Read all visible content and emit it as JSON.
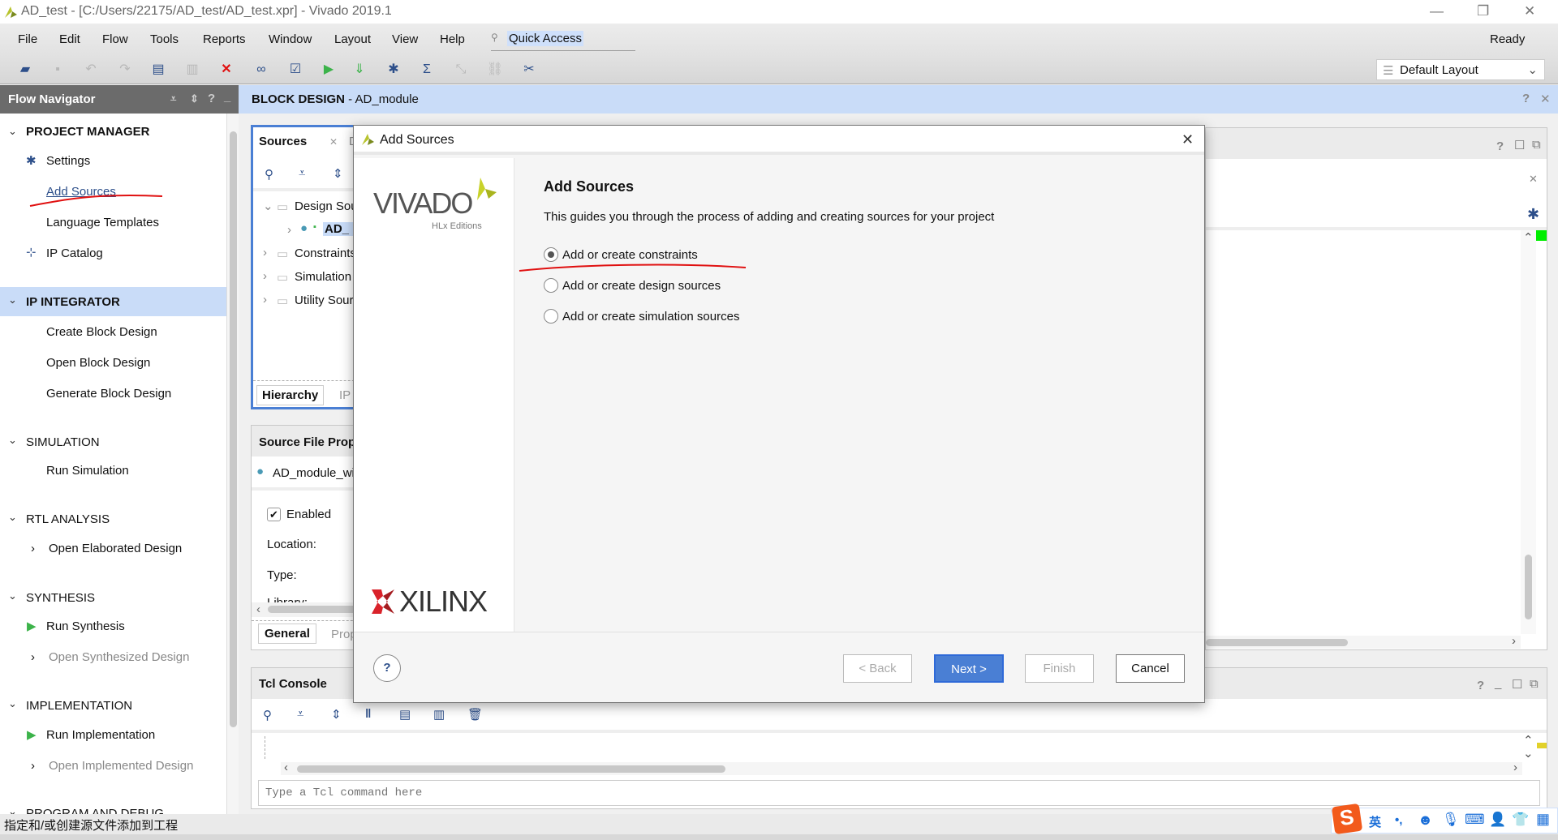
{
  "window": {
    "title": "AD_test - [C:/Users/22175/AD_test/AD_test.xpr] - Vivado 2019.1",
    "status": "Ready"
  },
  "menu": [
    "File",
    "Edit",
    "Flow",
    "Tools",
    "Reports",
    "Window",
    "Layout",
    "View",
    "Help"
  ],
  "quick_access": "Quick Access",
  "layout_select": "Default Layout",
  "flow_navigator": {
    "title": "Flow Navigator",
    "sections": [
      {
        "label": "PROJECT MANAGER",
        "items": [
          "Settings",
          "Add Sources",
          "Language Templates",
          "IP Catalog"
        ]
      },
      {
        "label": "IP INTEGRATOR",
        "items": [
          "Create Block Design",
          "Open Block Design",
          "Generate Block Design"
        ]
      },
      {
        "label": "SIMULATION",
        "items": [
          "Run Simulation"
        ]
      },
      {
        "label": "RTL ANALYSIS",
        "items": [
          "Open Elaborated Design"
        ]
      },
      {
        "label": "SYNTHESIS",
        "items": [
          "Run Synthesis",
          "Open Synthesized Design"
        ]
      },
      {
        "label": "IMPLEMENTATION",
        "items": [
          "Run Implementation",
          "Open Implemented Design"
        ]
      },
      {
        "label": "PROGRAM AND DEBUG",
        "items": []
      }
    ]
  },
  "block_design": {
    "title": "BLOCK DESIGN",
    "name": " - AD_module"
  },
  "sources": {
    "tab": "Sources",
    "tab2": "D",
    "tree": [
      "Design Sou",
      "AD_",
      "Constraints",
      "Simulation",
      "Utility Sourc"
    ],
    "bottom_tabs": [
      "Hierarchy",
      "IP"
    ]
  },
  "props": {
    "title": "Source File Prop",
    "file": "AD_module_wi",
    "enabled": "Enabled",
    "location": "Location:",
    "type": "Type:",
    "library": "Library:",
    "tabs": [
      "General",
      "Prop"
    ]
  },
  "tcl": {
    "title": "Tcl Console",
    "placeholder": "Type a Tcl command here"
  },
  "dialog": {
    "title": "Add Sources",
    "heading": "Add Sources",
    "description": "This guides you through the process of adding and creating sources for your project",
    "options": [
      {
        "label": "Add or create constraints",
        "selected": true
      },
      {
        "label": "Add or create design sources",
        "selected": false
      },
      {
        "label": "Add or create simulation sources",
        "selected": false
      }
    ],
    "logo_vivado": "VIVADO",
    "logo_hlx": "HLx Editions",
    "logo_xilinx": "XILINX",
    "buttons": {
      "help": "?",
      "back": "< Back",
      "next": "Next >",
      "finish": "Finish",
      "cancel": "Cancel"
    }
  },
  "status_text": "指定和/或创建源文件添加到工程",
  "ime": {
    "lang": "英",
    "punct": "•,"
  },
  "colors": {
    "accent": "#4a7fd4",
    "nav_selected": "#c9dcf8",
    "run_green": "#3cb34a",
    "annotation_red": "#e01010"
  }
}
